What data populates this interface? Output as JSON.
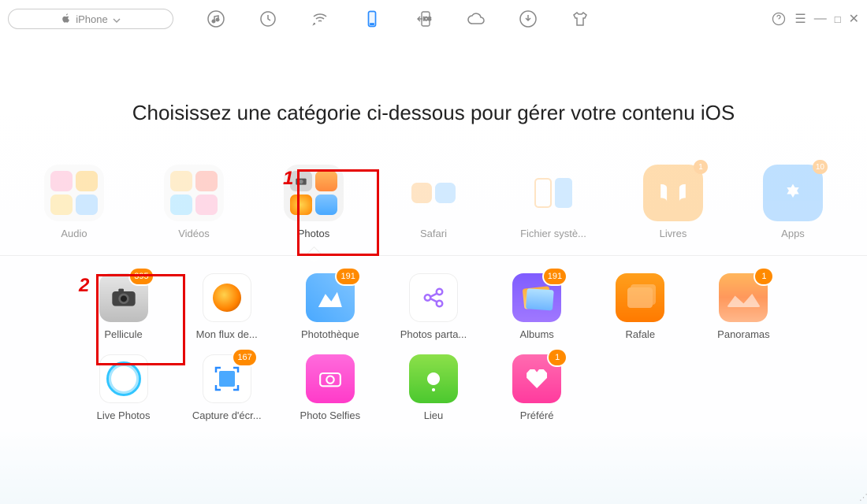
{
  "device": {
    "name": "iPhone"
  },
  "heading": "Choisissez une catégorie ci-dessous pour gérer votre contenu iOS",
  "annotations": {
    "one": "1",
    "two": "2"
  },
  "categories": [
    {
      "label": "Audio",
      "badge": null
    },
    {
      "label": "Vidéos",
      "badge": null
    },
    {
      "label": "Photos",
      "badge": null
    },
    {
      "label": "Safari",
      "badge": null
    },
    {
      "label": "Fichier systè...",
      "badge": null
    },
    {
      "label": "Livres",
      "badge": "1"
    },
    {
      "label": "Apps",
      "badge": "10"
    }
  ],
  "sub": [
    {
      "label": "Pellicule",
      "badge": "395"
    },
    {
      "label": "Mon flux de...",
      "badge": null
    },
    {
      "label": "Photothèque",
      "badge": "191"
    },
    {
      "label": "Photos parta...",
      "badge": null
    },
    {
      "label": "Albums",
      "badge": "191"
    },
    {
      "label": "Rafale",
      "badge": null
    },
    {
      "label": "Panoramas",
      "badge": "1"
    },
    {
      "label": "Live Photos",
      "badge": null
    },
    {
      "label": "Capture d'écr...",
      "badge": "167"
    },
    {
      "label": "Photo Selfies",
      "badge": null
    },
    {
      "label": "Lieu",
      "badge": null
    },
    {
      "label": "Préféré",
      "badge": "1"
    }
  ]
}
